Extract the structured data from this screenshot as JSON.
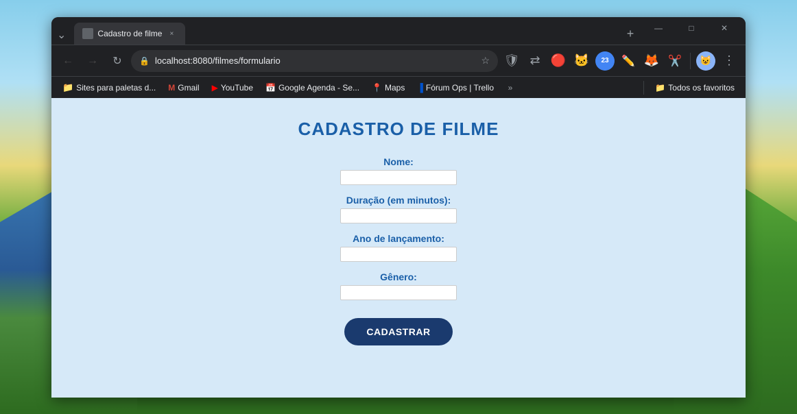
{
  "wallpaper": {
    "description": "Animated landscape wallpaper"
  },
  "browser": {
    "tab": {
      "favicon_alt": "page-icon",
      "title": "Cadastro de filme",
      "close_label": "×"
    },
    "new_tab_label": "+",
    "window_controls": {
      "minimize": "—",
      "maximize": "□",
      "close": "✕"
    },
    "toolbar": {
      "back_label": "←",
      "forward_label": "→",
      "refresh_label": "↻",
      "url": "localhost:8080/filmes/formulario",
      "star_label": "☆"
    },
    "bookmarks": {
      "items": [
        {
          "label": "Sites para paletas d...",
          "icon": "📁"
        },
        {
          "label": "Gmail",
          "icon": "M"
        },
        {
          "label": "YouTube",
          "icon": "▶"
        },
        {
          "label": "Google Agenda - Se...",
          "icon": "📅"
        },
        {
          "label": "Maps",
          "icon": "📍"
        },
        {
          "label": "Fórum Ops | Trello",
          "icon": "🔷"
        }
      ],
      "more_label": "»",
      "favorites_label": "Todos os favoritos",
      "favorites_icon": "📁"
    }
  },
  "page": {
    "title": "CADASTRO DE FILME",
    "form": {
      "fields": [
        {
          "label": "Nome:",
          "name": "nome",
          "placeholder": ""
        },
        {
          "label": "Duração (em minutos):",
          "name": "duracao",
          "placeholder": ""
        },
        {
          "label": "Ano de lançamento:",
          "name": "ano",
          "placeholder": ""
        },
        {
          "label": "Gênero:",
          "name": "genero",
          "placeholder": ""
        }
      ],
      "submit_label": "CADASTRAR"
    }
  }
}
